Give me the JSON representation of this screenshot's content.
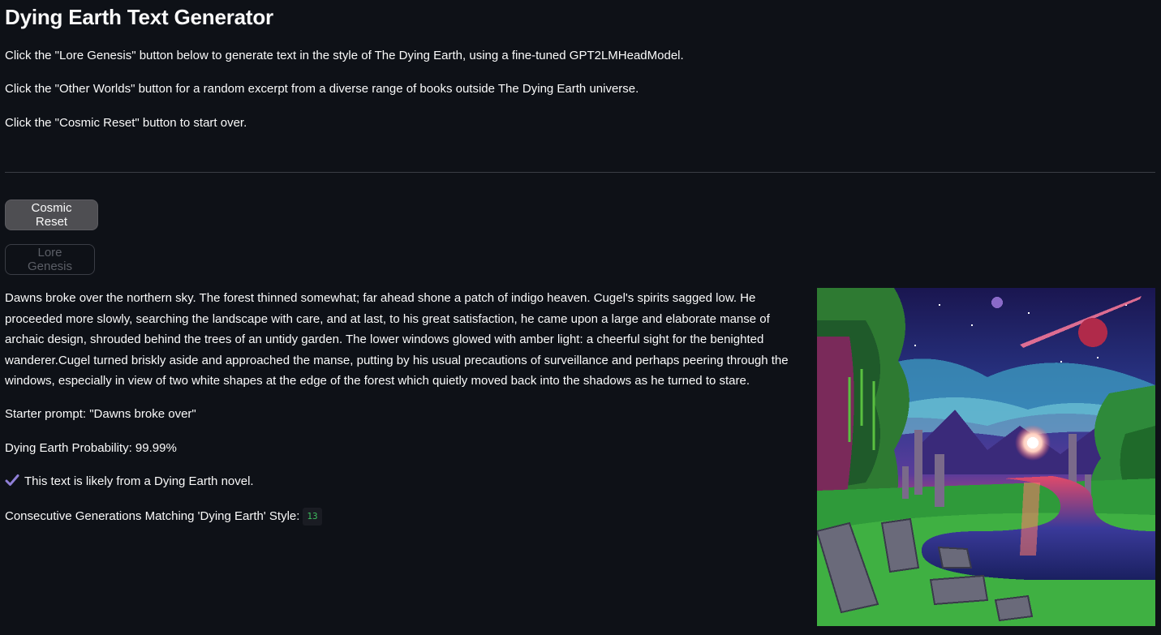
{
  "app": {
    "title": "Dying Earth Text Generator"
  },
  "intro": {
    "lines": [
      "Click the \"Lore Genesis\" button below to generate text in the style of The Dying Earth, using a fine-tuned GPT2LMHeadModel.",
      "Click the \"Other Worlds\" button for a random excerpt from a diverse range of books outside The Dying Earth universe.",
      "Click the \"Cosmic Reset\" button to start over."
    ]
  },
  "buttons": {
    "reset_label": "Cosmic Reset",
    "lore_label": "Lore Genesis"
  },
  "output": {
    "generated_text": "Dawns broke over the northern sky. The forest thinned somewhat; far ahead shone a patch of indigo heaven. Cugel's spirits sagged low. He proceeded more slowly, searching the landscape with care, and at last, to his great satisfaction, he came upon a large and elaborate manse of archaic design, shrouded behind the trees of an untidy garden. The lower windows glowed with amber light: a cheerful sight for the benighted wanderer.Cugel turned briskly aside and approached the manse, putting by his usual precautions of surveillance and perhaps peering through the windows, especially in view of two white shapes at the edge of the forest which quietly moved back into the shadows as he turned to stare.",
    "starter_prompt": "Starter prompt: \"Dawns broke over\"",
    "probability": "Dying Earth Probability: 99.99%",
    "verdict": "This text is likely from a Dying Earth novel.",
    "verdict_icon": "check-icon",
    "consecutive_label": "Consecutive Generations Matching 'Dying Earth' Style:",
    "consecutive_count": "13"
  },
  "image": {
    "icon": "pixel-art-landscape"
  },
  "colors": {
    "background": "#0e1117",
    "text": "#fafafa",
    "reset_button": "#4e4e52",
    "badge_text": "#3dbd5d",
    "check": "#8f7fd6"
  }
}
